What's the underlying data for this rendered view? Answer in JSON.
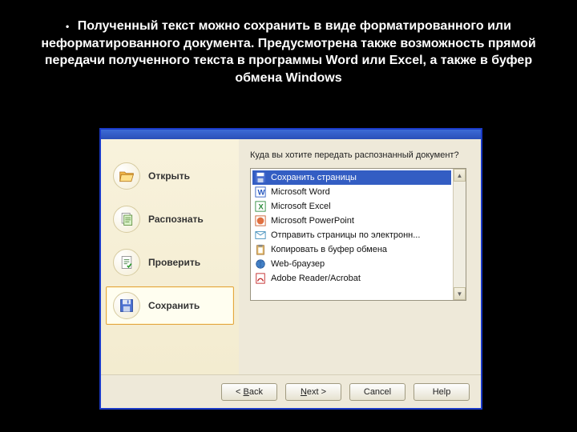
{
  "slide": {
    "text": "Полученный текст можно сохранить в виде форматированного или неформатированного документа. Предусмотрена также возможность прямой передачи полученного текста в программы Word или Excel, а также в буфер обмена Windows"
  },
  "sidebar": {
    "items": [
      {
        "label": "Открыть",
        "icon": "folder-open-icon"
      },
      {
        "label": "Распознать",
        "icon": "pages-icon"
      },
      {
        "label": "Проверить",
        "icon": "check-page-icon"
      },
      {
        "label": "Сохранить",
        "icon": "floppy-icon"
      }
    ],
    "selected_index": 3
  },
  "panel": {
    "question": "Куда вы хотите передать распознанный документ?",
    "options": [
      {
        "label": "Сохранить страницы",
        "icon": "floppy"
      },
      {
        "label": "Microsoft Word",
        "icon": "word"
      },
      {
        "label": "Microsoft Excel",
        "icon": "excel"
      },
      {
        "label": "Microsoft PowerPoint",
        "icon": "ppt"
      },
      {
        "label": "Отправить страницы по электронн...",
        "icon": "mail"
      },
      {
        "label": "Копировать в буфер обмена",
        "icon": "clip"
      },
      {
        "label": "Web-браузер",
        "icon": "globe"
      },
      {
        "label": "Adobe Reader/Acrobat",
        "icon": "pdf"
      }
    ],
    "selected_index": 0
  },
  "buttons": {
    "back": "< Back",
    "next": "Next >",
    "cancel": "Cancel",
    "help": "Help"
  }
}
